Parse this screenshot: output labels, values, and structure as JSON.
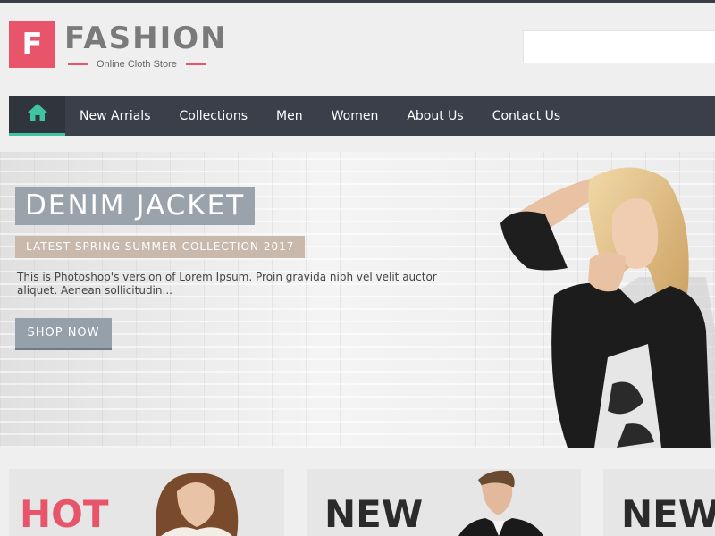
{
  "brand": {
    "logo_letter": "F",
    "name": "FASHION",
    "tagline": "Online Cloth Store",
    "accent_color": "#e8546a"
  },
  "search": {
    "placeholder": ""
  },
  "nav": {
    "home_icon": "home-icon",
    "active_color": "#3fc3a3",
    "items": [
      {
        "label": "New Arrials"
      },
      {
        "label": "Collections"
      },
      {
        "label": "Men"
      },
      {
        "label": "Women"
      },
      {
        "label": "About Us"
      },
      {
        "label": "Contact Us"
      }
    ]
  },
  "hero": {
    "title": "DENIM JACKET",
    "subtitle": "LATEST SPRING SUMMER COLLECTION 2017",
    "description": "This is Photoshop's version of Lorem Ipsum. Proin gravida nibh vel velit auctor aliquet. Aenean sollicitudin...",
    "cta": "SHOP NOW"
  },
  "cards": [
    {
      "label": "HOT"
    },
    {
      "label": "NEW"
    },
    {
      "label": "NEW"
    }
  ]
}
